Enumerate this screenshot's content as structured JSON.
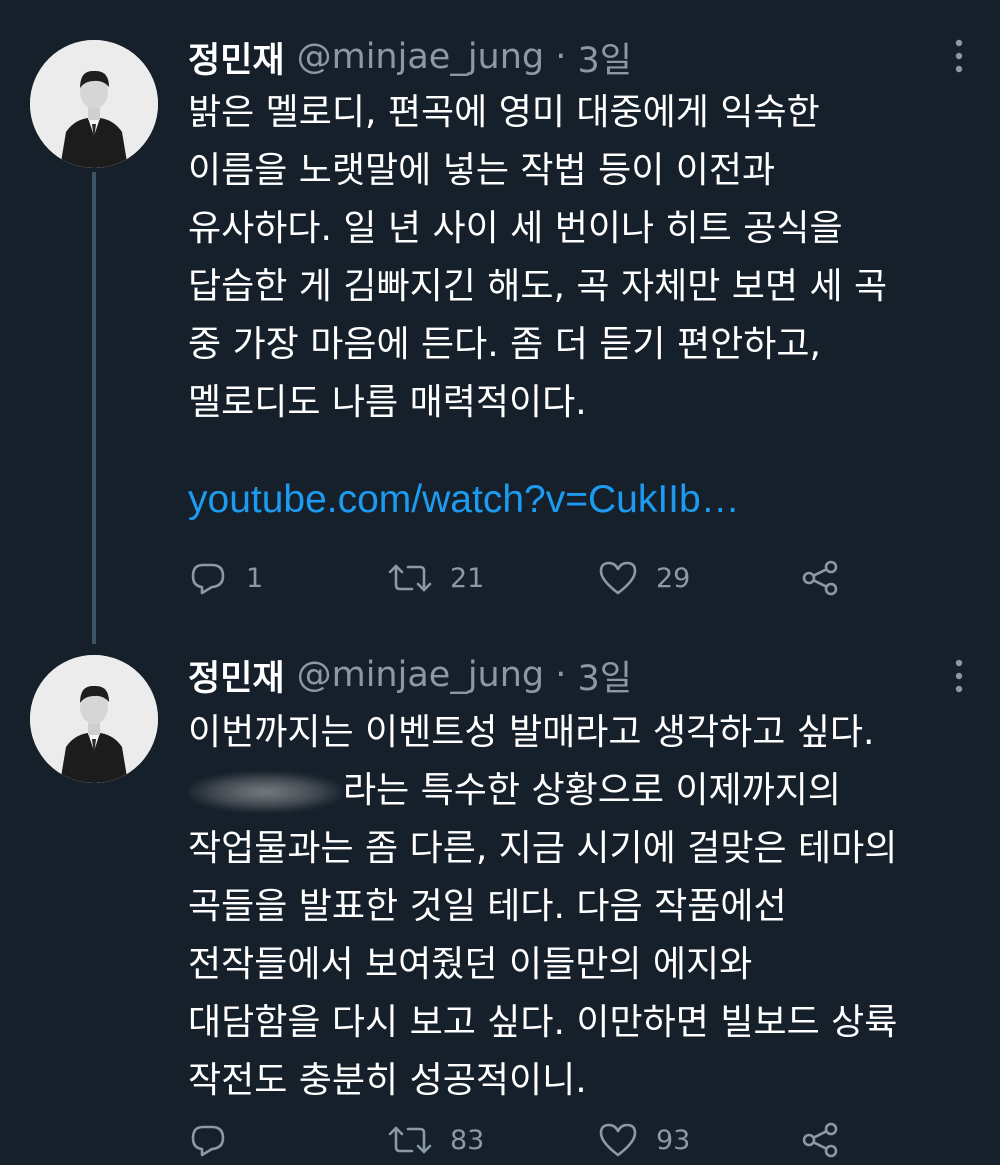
{
  "colors": {
    "background": "#15202b",
    "text": "#ffffff",
    "muted": "#8b98a5",
    "link": "#1d9bf0",
    "thread_line": "#3d5466"
  },
  "tweets": [
    {
      "author": {
        "name": "정민재",
        "handle": "@minjae_jung",
        "time": "3일"
      },
      "lines": [
        "밝은 멜로디, 편곡에 영미 대중에게 익숙한",
        "이름을 노랫말에 넣는 작법 등이 이전과",
        "유사하다. 일 년 사이 세 번이나 히트 공식을",
        "답습한 게 김빠지긴 해도, 곡 자체만 보면 세 곡",
        "중 가장 마음에 든다. 좀 더 듣기 편안하고,",
        "멜로디도 나름 매력적이다."
      ],
      "link": "youtube.com/watch?v=CukIIb…",
      "stats": {
        "replies": "1",
        "retweets": "21",
        "likes": "29"
      },
      "icons": [
        "reply-icon",
        "retweet-icon",
        "like-icon",
        "share-icon",
        "more-icon"
      ]
    },
    {
      "author": {
        "name": "정민재",
        "handle": "@minjae_jung",
        "time": "3일"
      },
      "lines": [
        "이번까지는 이벤트성 발매라고 생각하고 싶다.",
        "라는 특수한 상황으로 이제까지의",
        "작업물과는 좀 다른, 지금 시기에 걸맞은 테마의",
        "곡들을 발표한 것일 테다. 다음 작품에선",
        "전작들에서 보여줬던 이들만의 에지와",
        "대담함을 다시 보고 싶다. 이만하면 빌보드 상륙",
        "작전도 충분히 성공적이니."
      ],
      "stats": {
        "replies": "",
        "retweets": "83",
        "likes": "93"
      },
      "icons": [
        "reply-icon",
        "retweet-icon",
        "like-icon",
        "share-icon",
        "more-icon"
      ]
    }
  ]
}
